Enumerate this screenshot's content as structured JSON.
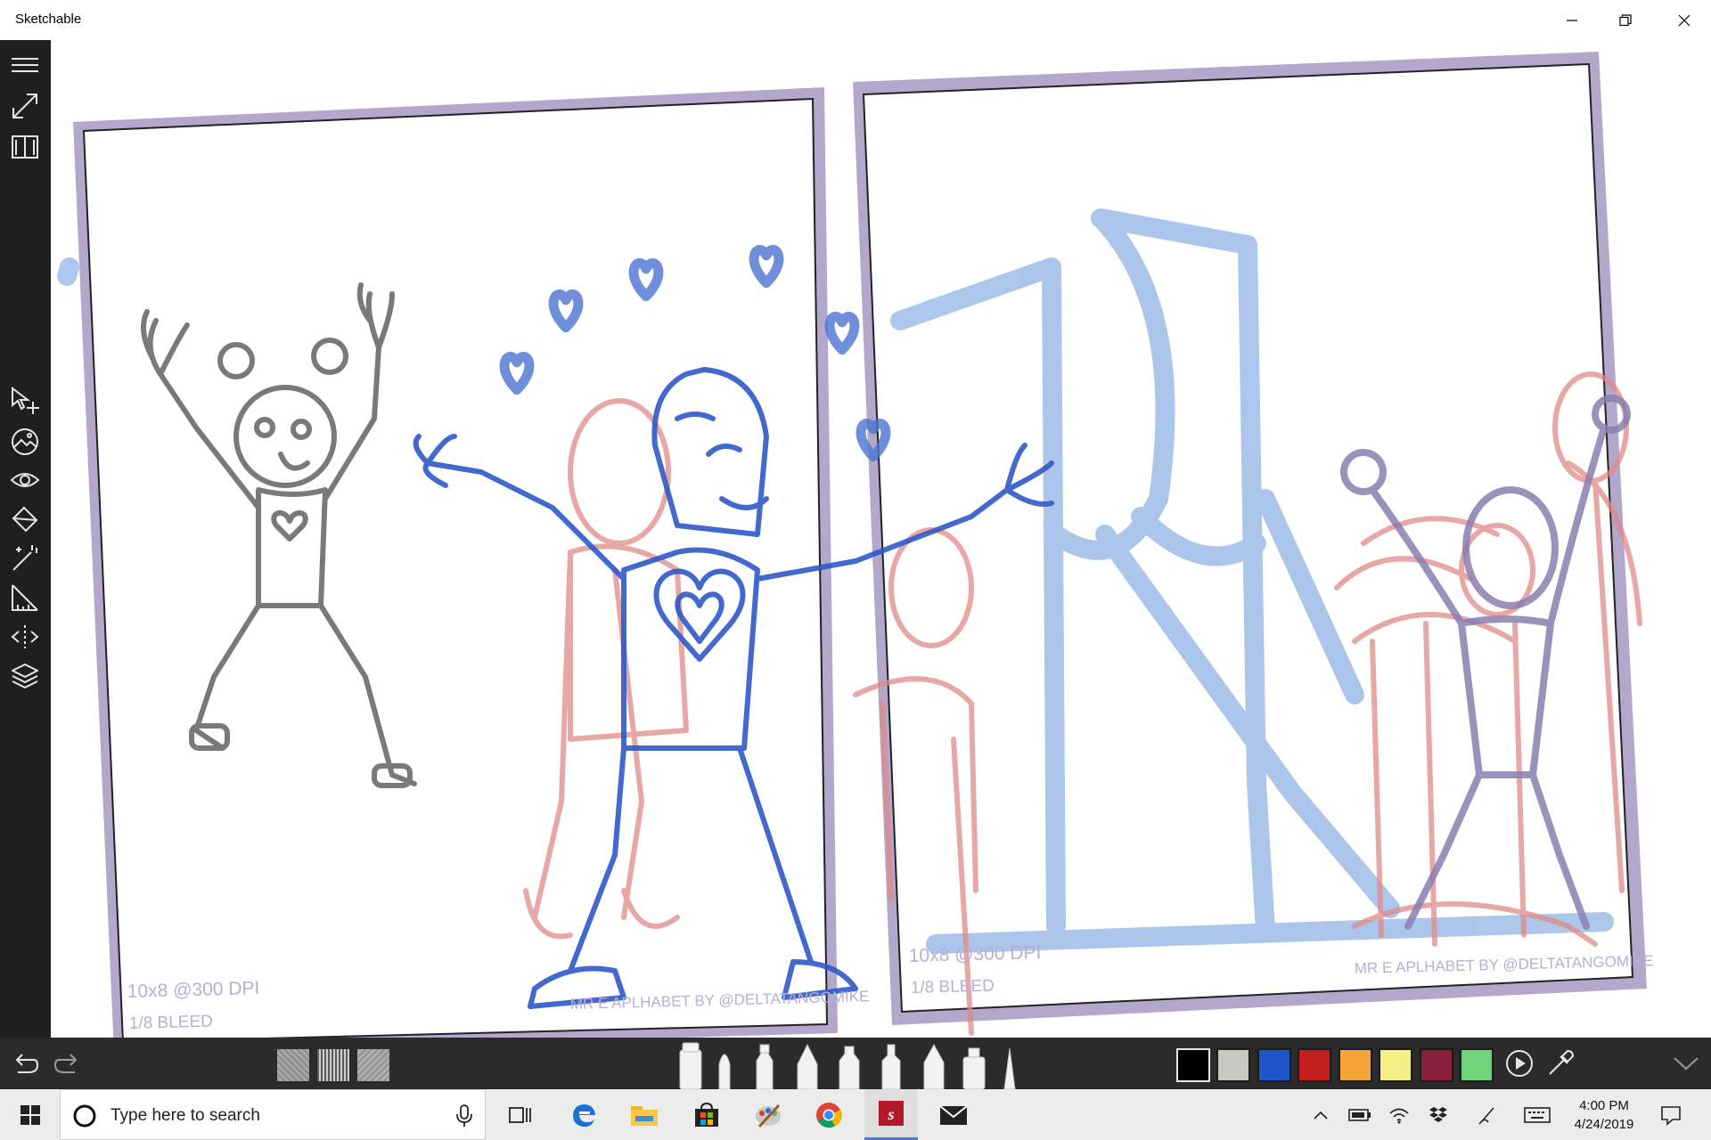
{
  "app": {
    "title": "Sketchable"
  },
  "window_controls": {
    "minimize": "minimize-icon",
    "restore": "restore-icon",
    "close": "close-icon"
  },
  "sidebar": {
    "top_tools": [
      "menu-icon",
      "fullscreen-icon",
      "book-icon"
    ],
    "tools": [
      "select-move-icon",
      "image-insert-icon",
      "visibility-icon",
      "fill-bucket-icon",
      "magic-wand-icon",
      "ruler-icon",
      "symmetry-icon",
      "layers-icon"
    ]
  },
  "canvas": {
    "left_page": {
      "size_label": "10x8 @300 DPI",
      "bleed_label": "1/8 BLEED",
      "credit": "MR E APLHABET BY @DELTATANGOMIKE"
    },
    "right_page": {
      "size_label": "10x8 @300 DPI",
      "bleed_label": "1/8 BLEED",
      "credit": "MR E APLHABET BY @DELTATANGOMIKE"
    },
    "ink_colors": {
      "pencil": "#6b6b6b",
      "blue": "#2f58c9",
      "red": "#e08a86",
      "light_blue": "#9ebde8",
      "purple": "#8a7fb0",
      "page_border": "#b3a7cc"
    }
  },
  "bottom_toolbar": {
    "undo": "undo-icon",
    "redo": "redo-icon",
    "papers": [
      "paper-texture-1",
      "paper-texture-2",
      "paper-texture-3"
    ],
    "brushes": [
      "marker",
      "brush",
      "felt-pen",
      "pencil",
      "crayon",
      "highlighter",
      "fountain-pen",
      "spray-can",
      "airbrush"
    ],
    "colors": [
      "#000000",
      "#c8c8c0",
      "#1f55c8",
      "#c41f1f",
      "#f2a33a",
      "#f4ef86",
      "#8a1f3c",
      "#6ed37a"
    ],
    "play": "play-icon",
    "eyedropper": "eyedropper-icon",
    "collapse": "chevron-down-icon"
  },
  "taskbar": {
    "search_placeholder": "Type here to search",
    "apps": [
      "task-view-icon",
      "edge-icon",
      "file-explorer-icon",
      "store-icon",
      "paint-icon",
      "chrome-icon",
      "sketchable-icon",
      "mail-icon"
    ],
    "tray": [
      "chevron-up-icon",
      "battery-icon",
      "wifi-icon",
      "dropbox-icon",
      "pen-icon",
      "keyboard-icon"
    ],
    "time": "4:00 PM",
    "date": "4/24/2019",
    "notifications": "notification-icon"
  }
}
